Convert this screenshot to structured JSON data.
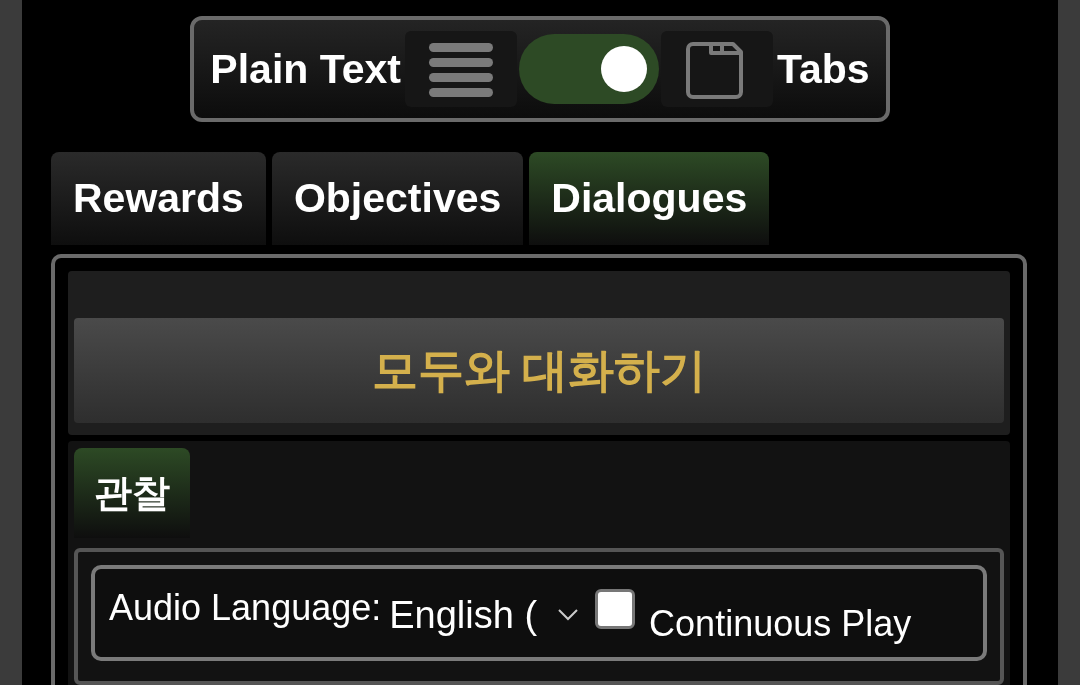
{
  "view_toggle": {
    "left_label": "Plain Text",
    "right_label": "Tabs",
    "on": true
  },
  "tabs": [
    {
      "label": "Rewards",
      "selected": false
    },
    {
      "label": "Objectives",
      "selected": false
    },
    {
      "label": "Dialogues",
      "selected": true
    }
  ],
  "dialogue": {
    "title": "모두와 대화하기",
    "subtabs": [
      {
        "label": "관찰",
        "selected": true
      }
    ],
    "audio_language": {
      "label": "Audio Language:",
      "value": "English ("
    },
    "continuous_play": {
      "label": "Continuous Play",
      "checked": false
    }
  }
}
